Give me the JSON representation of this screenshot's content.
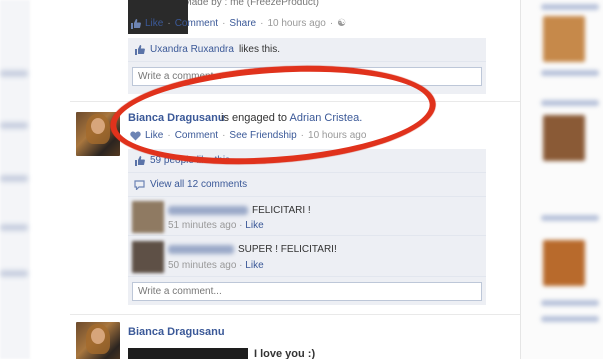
{
  "top_post": {
    "caption": "Paul Young Made by : me (FreezeProduct)",
    "actions": {
      "like": "Like",
      "comment": "Comment",
      "share": "Share",
      "time": "10 hours ago"
    },
    "likes_text": {
      "name": "Uxandra Ruxandra",
      "suffix": "likes this."
    },
    "comment_placeholder": "Write a comment..."
  },
  "engaged_post": {
    "author": "Bianca Dragusanu",
    "story_prefix": "is engaged to",
    "partner": "Adrian Cristea.",
    "actions": {
      "like": "Like",
      "comment": "Comment",
      "see_friendship": "See Friendship",
      "time": "10 hours ago"
    },
    "likes_text": "59 people like this.",
    "view_comments": "View all 12 comments",
    "comments": [
      {
        "text": "FELICITARI !",
        "time": "51 minutes ago",
        "like": "Like"
      },
      {
        "text": "SUPER ! FELICITARI!",
        "time": "50 minutes ago",
        "like": "Like"
      }
    ],
    "comment_placeholder": "Write a comment..."
  },
  "bottom_post": {
    "author": "Bianca Dragusanu",
    "text": "I love you :)"
  },
  "colors": {
    "link": "#3b5998",
    "highlight_oval": "#e0321c",
    "box_bg": "#edeff4"
  },
  "icons": [
    "like-thumb-icon",
    "share-people-icon",
    "speech-bubble-icon"
  ]
}
